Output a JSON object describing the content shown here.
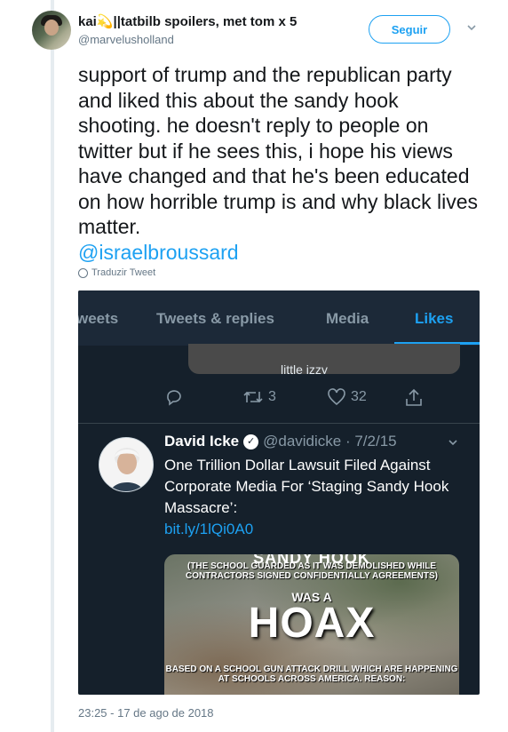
{
  "tweet": {
    "display_name": "kai💫||tatbilb spoilers, met tom x 5",
    "handle": "@marvelusholland",
    "follow_label": "Seguir",
    "text": "support of trump and the republican party and liked this about the sandy hook shooting. he doesn't reply to people on twitter but if he sees this, i hope his views have changed and that he's been educated on how horrible trump is and why black lives matter.",
    "mention": "@israelbroussard",
    "translate_label": "Traduzir Tweet",
    "timestamp": "23:25 - 17 de ago de 2018"
  },
  "screenshot": {
    "tabs": [
      {
        "label": "weets"
      },
      {
        "label": "Tweets & replies"
      },
      {
        "label": "Media"
      },
      {
        "label": "Likes"
      }
    ],
    "prev_caption": "little izzy",
    "actions": {
      "retweets": "3",
      "likes": "32"
    },
    "embedded": {
      "name": "David Icke",
      "handle_date": "@davidicke · 7/2/15",
      "text": "One Trillion Dollar Lawsuit Filed Against Corporate Media For ‘Staging Sandy Hook Massacre’:",
      "link": "bit.ly/1lQi0A0",
      "image": {
        "top_line": "SANDY HOOK",
        "small_top": "(THE SCHOOL GUARDED AS IT WAS DEMOLISHED WHILE CONTRACTORS SIGNED CONFIDENTIALLY AGREEMENTS)",
        "was_a": "WAS A",
        "hoax": "HOAX",
        "small_bottom": "BASED ON A SCHOOL GUN ATTACK DRILL WHICH ARE HAPPENING AT SCHOOLS ACROSS AMERICA. REASON:"
      }
    }
  },
  "colors": {
    "accent": "#1da1f2",
    "dark_bg": "#15202b",
    "muted": "#657786"
  }
}
